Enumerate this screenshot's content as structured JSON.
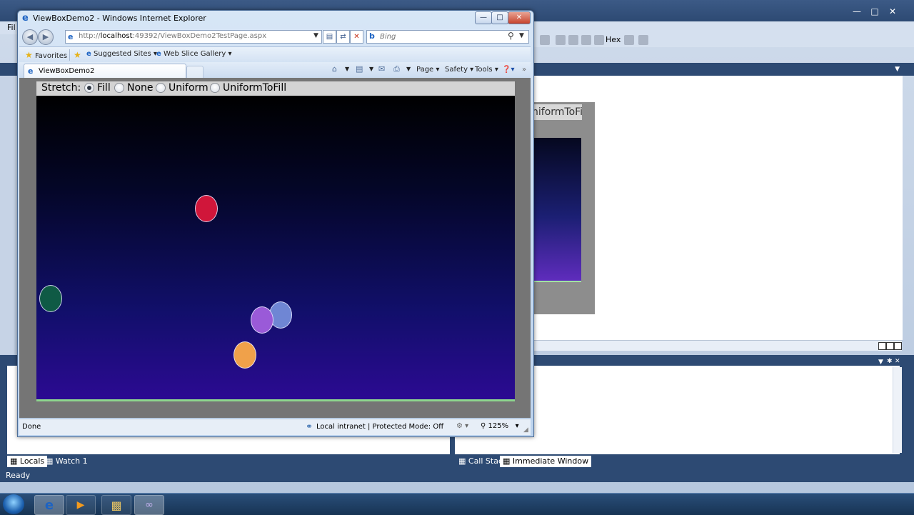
{
  "vs": {
    "menu": [
      "Fil",
      "",
      ""
    ],
    "hex_label": "Hex",
    "preview_header": "niformToFi",
    "bottom_tabs": {
      "locals": "Locals",
      "watch": "Watch 1",
      "call_stack": "Call Stack",
      "immediate": "Immediate Window"
    },
    "status": "Ready"
  },
  "ie": {
    "window_title": "ViewBoxDemo2 - Windows Internet Explorer",
    "address": {
      "prefix": "http://",
      "host": "localhost",
      "rest": ":49392/ViewBoxDemo2TestPage.aspx"
    },
    "search_placeholder": "Bing",
    "favorites": {
      "favorites": "Favorites",
      "suggested": "Suggested Sites",
      "slice": "Web Slice Gallery"
    },
    "tab_title": "ViewBoxDemo2",
    "commands": {
      "page": "Page",
      "safety": "Safety",
      "tools": "Tools"
    },
    "status": {
      "done": "Done",
      "zone": "Local intranet | Protected Mode: Off",
      "zoom": "125%"
    }
  },
  "app": {
    "stretch_label": "Stretch:",
    "options": [
      {
        "label": "Fill",
        "checked": true
      },
      {
        "label": "None",
        "checked": false
      },
      {
        "label": "Uniform",
        "checked": false
      },
      {
        "label": "UniformToFill",
        "checked": false
      }
    ],
    "colors": {
      "red_ball": "#d0163a",
      "teal_ball": "#0f5a45",
      "purple_ball": "#9a5ad8",
      "blue_ball": "#6f86d4",
      "orange_ball": "#f0a14a",
      "floor": "#8ed68e"
    }
  }
}
